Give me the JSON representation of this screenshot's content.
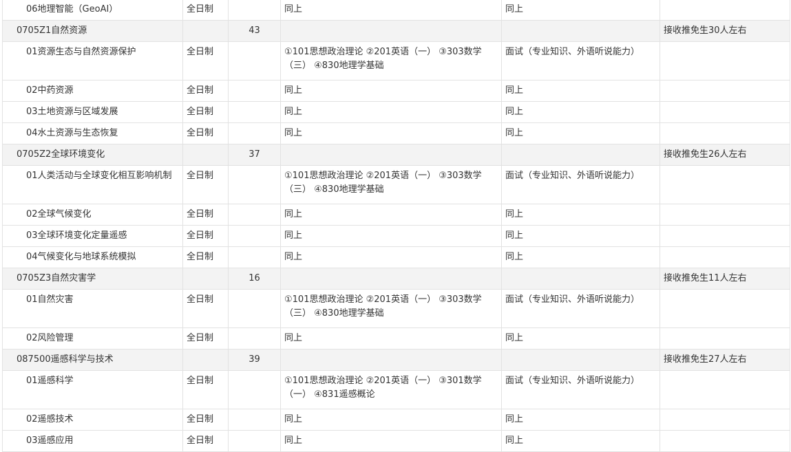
{
  "rows": [
    {
      "type": "minor",
      "lines": 1,
      "name": "06地理智能（GeoAI）",
      "mode": "全日制",
      "num": "",
      "exam": "同上",
      "retest": "同上",
      "note": ""
    },
    {
      "type": "major",
      "name": "0705Z1自然资源",
      "mode": "",
      "num": "43",
      "exam": "",
      "retest": "",
      "note": "接收推免生30人左右"
    },
    {
      "type": "minor",
      "lines": 2,
      "name": "01资源生态与自然资源保护",
      "mode": "全日制",
      "num": "",
      "exam": "①101思想政治理论 ②201英语（一） ③303数学（三） ④830地理学基础",
      "retest": "面试（专业知识、外语听说能力）",
      "note": ""
    },
    {
      "type": "minor",
      "lines": 1,
      "name": "02中药资源",
      "mode": "全日制",
      "num": "",
      "exam": "同上",
      "retest": "同上",
      "note": ""
    },
    {
      "type": "minor",
      "lines": 1,
      "name": "03土地资源与区域发展",
      "mode": "全日制",
      "num": "",
      "exam": "同上",
      "retest": "同上",
      "note": ""
    },
    {
      "type": "minor",
      "lines": 1,
      "name": "04水土资源与生态恢复",
      "mode": "全日制",
      "num": "",
      "exam": "同上",
      "retest": "同上",
      "note": ""
    },
    {
      "type": "major",
      "name": "0705Z2全球环境变化",
      "mode": "",
      "num": "37",
      "exam": "",
      "retest": "",
      "note": "接收推免生26人左右"
    },
    {
      "type": "minor",
      "lines": 2,
      "wrapname": true,
      "name": "01人类活动与全球变化相互影响机制",
      "mode": "全日制",
      "num": "",
      "exam": "①101思想政治理论 ②201英语（一） ③303数学（三） ④830地理学基础",
      "retest": "面试（专业知识、外语听说能力）",
      "note": ""
    },
    {
      "type": "minor",
      "lines": 1,
      "name": "02全球气候变化",
      "mode": "全日制",
      "num": "",
      "exam": "同上",
      "retest": "同上",
      "note": ""
    },
    {
      "type": "minor",
      "lines": 1,
      "name": "03全球环境变化定量遥感",
      "mode": "全日制",
      "num": "",
      "exam": "同上",
      "retest": "同上",
      "note": ""
    },
    {
      "type": "minor",
      "lines": 1,
      "name": "04气候变化与地球系统模拟",
      "mode": "全日制",
      "num": "",
      "exam": "同上",
      "retest": "同上",
      "note": ""
    },
    {
      "type": "major",
      "name": "0705Z3自然灾害学",
      "mode": "",
      "num": "16",
      "exam": "",
      "retest": "",
      "note": "接收推免生11人左右"
    },
    {
      "type": "minor",
      "lines": 2,
      "name": "01自然灾害",
      "mode": "全日制",
      "num": "",
      "exam": "①101思想政治理论 ②201英语（一） ③303数学（三） ④830地理学基础",
      "retest": "面试（专业知识、外语听说能力）",
      "note": ""
    },
    {
      "type": "minor",
      "lines": 1,
      "name": "02风险管理",
      "mode": "全日制",
      "num": "",
      "exam": "同上",
      "retest": "同上",
      "note": ""
    },
    {
      "type": "major",
      "name": "087500遥感科学与技术",
      "mode": "",
      "num": "39",
      "exam": "",
      "retest": "",
      "note": "接收推免生27人左右"
    },
    {
      "type": "minor",
      "lines": 2,
      "name": "01遥感科学",
      "mode": "全日制",
      "num": "",
      "exam": "①101思想政治理论 ②201英语（一） ③301数学（一） ④831遥感概论",
      "retest": "面试（专业知识、外语听说能力）",
      "note": ""
    },
    {
      "type": "minor",
      "lines": 1,
      "name": "02遥感技术",
      "mode": "全日制",
      "num": "",
      "exam": "同上",
      "retest": "同上",
      "note": ""
    },
    {
      "type": "minor",
      "lines": 1,
      "name": "03遥感应用",
      "mode": "全日制",
      "num": "",
      "exam": "同上",
      "retest": "同上",
      "note": ""
    }
  ]
}
